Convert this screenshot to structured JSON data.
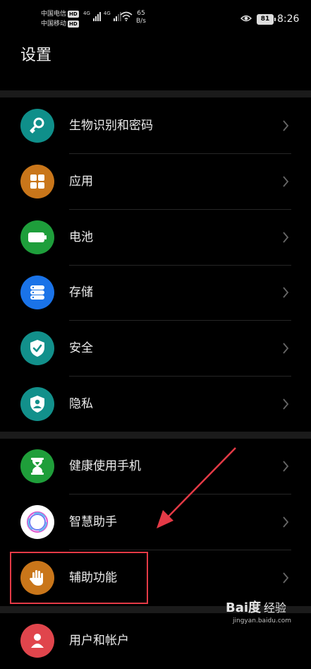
{
  "status_bar": {
    "carrier_1": "中国电信",
    "carrier_2": "中国移动",
    "hd_badge": "HD",
    "network_type_1": "4G",
    "network_type_2": "4G",
    "net_speed_value": "65",
    "net_speed_unit": "B/s",
    "battery_level": "81",
    "time": "8:26"
  },
  "header": {
    "title": "设置"
  },
  "settings": {
    "items": [
      {
        "label": "生物识别和密码",
        "icon": "key-icon",
        "color": "#0f8f8a"
      },
      {
        "label": "应用",
        "icon": "apps-grid-icon",
        "color": "#c9761a"
      },
      {
        "label": "电池",
        "icon": "battery-icon",
        "color": "#1e9e3b"
      },
      {
        "label": "存储",
        "icon": "storage-icon",
        "color": "#1a73e8"
      },
      {
        "label": "安全",
        "icon": "shield-check-icon",
        "color": "#12908b"
      },
      {
        "label": "隐私",
        "icon": "privacy-shield-icon",
        "color": "#12908b"
      },
      {
        "label": "健康使用手机",
        "icon": "hourglass-icon",
        "color": "#1f9e3a"
      },
      {
        "label": "智慧助手",
        "icon": "smart-assistant-icon",
        "color": "#ffffff"
      },
      {
        "label": "辅助功能",
        "icon": "hand-icon",
        "color": "#c9761a"
      },
      {
        "label": "用户和帐户",
        "icon": "user-icon",
        "color": "#e0454c"
      }
    ]
  },
  "watermark": {
    "logo": "Bai度",
    "label": "经验",
    "url": "jingyan.baidu.com"
  }
}
